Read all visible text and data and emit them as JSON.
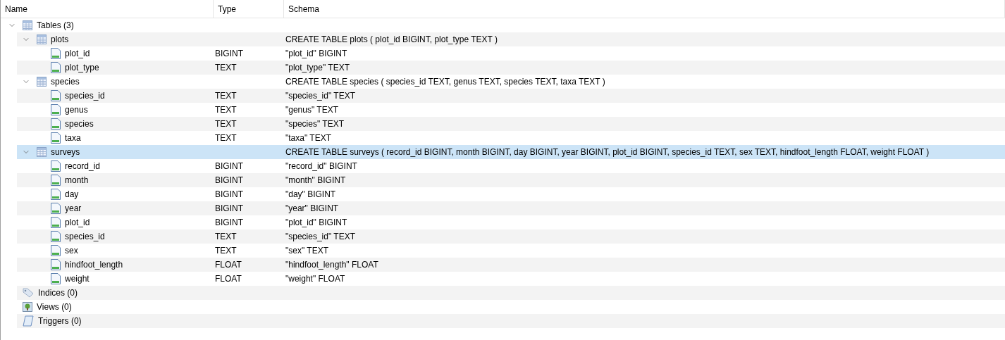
{
  "columns": [
    "Name",
    "Type",
    "Schema"
  ],
  "tree": [
    {
      "kind": "tables",
      "name": "Tables (3)",
      "expanded": true,
      "selected": false,
      "children": [
        {
          "kind": "table",
          "name": "plots",
          "schema": "CREATE TABLE plots ( plot_id BIGINT, plot_type TEXT )",
          "expanded": true,
          "selected": false,
          "children": [
            {
              "kind": "column",
              "name": "plot_id",
              "type": "BIGINT",
              "schema": "\"plot_id\" BIGINT",
              "selected": false
            },
            {
              "kind": "column",
              "name": "plot_type",
              "type": "TEXT",
              "schema": "\"plot_type\" TEXT",
              "selected": false
            }
          ]
        },
        {
          "kind": "table",
          "name": "species",
          "schema": "CREATE TABLE species ( species_id TEXT, genus TEXT, species TEXT, taxa TEXT )",
          "expanded": true,
          "selected": false,
          "children": [
            {
              "kind": "column",
              "name": "species_id",
              "type": "TEXT",
              "schema": "\"species_id\" TEXT",
              "selected": false
            },
            {
              "kind": "column",
              "name": "genus",
              "type": "TEXT",
              "schema": "\"genus\" TEXT",
              "selected": false
            },
            {
              "kind": "column",
              "name": "species",
              "type": "TEXT",
              "schema": "\"species\" TEXT",
              "selected": false
            },
            {
              "kind": "column",
              "name": "taxa",
              "type": "TEXT",
              "schema": "\"taxa\" TEXT",
              "selected": false
            }
          ]
        },
        {
          "kind": "table",
          "name": "surveys",
          "schema": "CREATE TABLE surveys ( record_id BIGINT, month BIGINT, day BIGINT, year BIGINT, plot_id BIGINT, species_id TEXT, sex TEXT, hindfoot_length FLOAT, weight FLOAT )",
          "expanded": true,
          "selected": true,
          "children": [
            {
              "kind": "column",
              "name": "record_id",
              "type": "BIGINT",
              "schema": "\"record_id\" BIGINT",
              "selected": false
            },
            {
              "kind": "column",
              "name": "month",
              "type": "BIGINT",
              "schema": "\"month\" BIGINT",
              "selected": false
            },
            {
              "kind": "column",
              "name": "day",
              "type": "BIGINT",
              "schema": "\"day\" BIGINT",
              "selected": false
            },
            {
              "kind": "column",
              "name": "year",
              "type": "BIGINT",
              "schema": "\"year\" BIGINT",
              "selected": false
            },
            {
              "kind": "column",
              "name": "plot_id",
              "type": "BIGINT",
              "schema": "\"plot_id\" BIGINT",
              "selected": false
            },
            {
              "kind": "column",
              "name": "species_id",
              "type": "TEXT",
              "schema": "\"species_id\" TEXT",
              "selected": false
            },
            {
              "kind": "column",
              "name": "sex",
              "type": "TEXT",
              "schema": "\"sex\" TEXT",
              "selected": false
            },
            {
              "kind": "column",
              "name": "hindfoot_length",
              "type": "FLOAT",
              "schema": "\"hindfoot_length\" FLOAT",
              "selected": false
            },
            {
              "kind": "column",
              "name": "weight",
              "type": "FLOAT",
              "schema": "\"weight\" FLOAT",
              "selected": false
            }
          ]
        }
      ]
    },
    {
      "kind": "indices",
      "name": "Indices (0)",
      "selected": false
    },
    {
      "kind": "views",
      "name": "Views (0)",
      "selected": false
    },
    {
      "kind": "triggers",
      "name": "Triggers (0)",
      "selected": false
    }
  ]
}
